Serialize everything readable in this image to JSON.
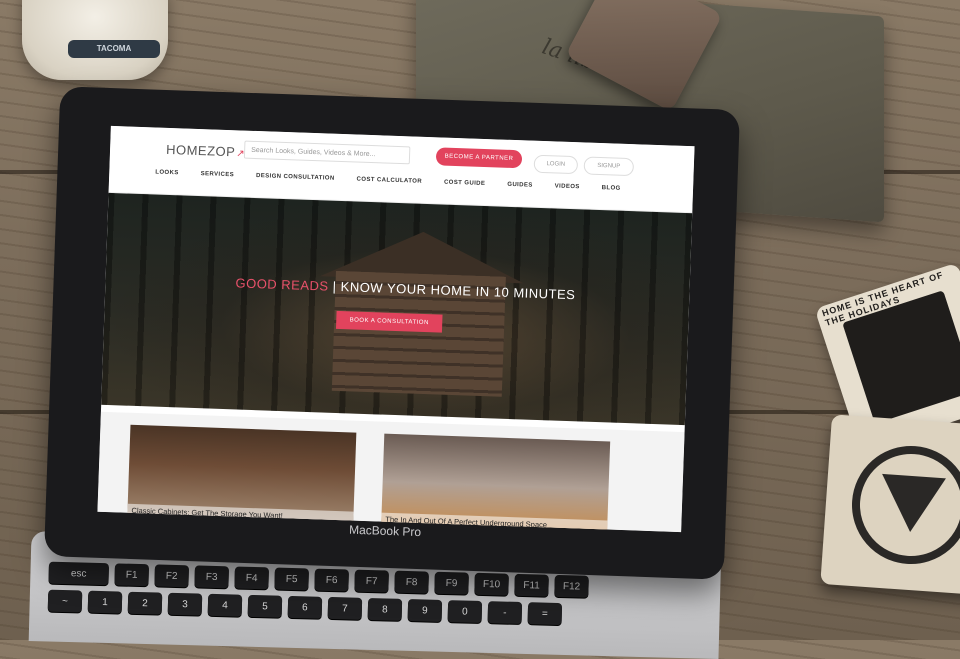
{
  "props": {
    "jar_label": "TACOMA",
    "pouch_text": "la libellule",
    "coaster_text": "HOME IS THE HEART OF THE HOLIDAYS"
  },
  "laptop": {
    "model_label": "MacBook Pro",
    "keyboard": {
      "row1": [
        "esc",
        "F1",
        "F2",
        "F3",
        "F4",
        "F5",
        "F6",
        "F7",
        "F8",
        "F9",
        "F10",
        "F11",
        "F12"
      ],
      "row2": [
        "~",
        "1",
        "2",
        "3",
        "4",
        "5",
        "6",
        "7",
        "8",
        "9",
        "0",
        "-",
        "="
      ]
    }
  },
  "site": {
    "logo": "HOMEZOP",
    "search_placeholder": "Search Looks, Guides, Videos & More...",
    "become_partner": "BECOME A PARTNER",
    "login": "LOGIN",
    "signup": "SIGNUP",
    "nav": [
      "LOOKS",
      "SERVICES",
      "DESIGN CONSULTATION",
      "COST CALCULATOR",
      "COST GUIDE",
      "GUIDES",
      "VIDEOS",
      "BLOG"
    ],
    "hero": {
      "accent": "GOOD READS",
      "title": "| KNOW YOUR HOME IN 10 MINUTES",
      "cta": "BOOK A CONSULTATION"
    },
    "cards": [
      {
        "caption": "Classic Cabinets: Get The Storage You Want!"
      },
      {
        "caption": "The In And Out Of A Perfect Underground Space"
      }
    ]
  },
  "colors": {
    "brand": "#e2435d",
    "laptop_bezel": "#1a1a1c"
  }
}
